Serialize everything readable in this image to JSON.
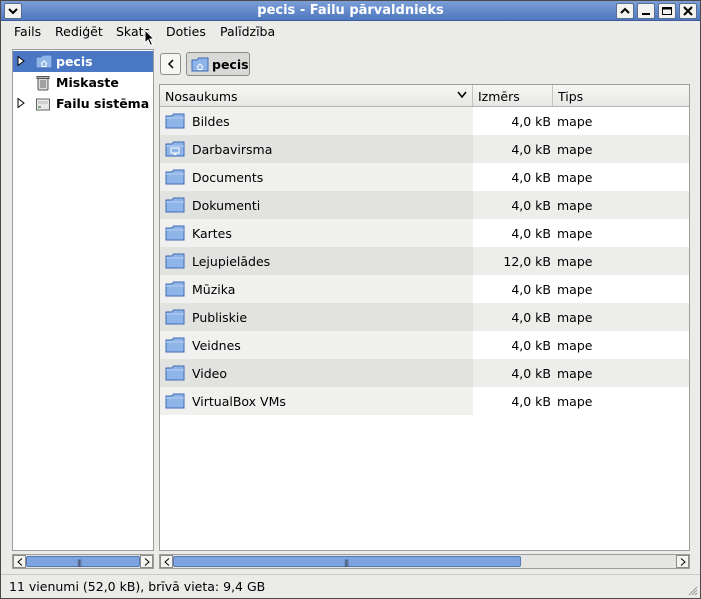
{
  "window": {
    "title": "pecis - Failu pārvaldnieks"
  },
  "titlebar_buttons": [
    {
      "name": "window-menu-button",
      "icon": "chevron-down-icon"
    },
    {
      "name": "shade-button",
      "icon": "chevron-up-icon"
    },
    {
      "name": "minimize-button",
      "icon": "minimize-icon"
    },
    {
      "name": "maximize-button",
      "icon": "maximize-icon"
    },
    {
      "name": "close-button",
      "icon": "close-icon"
    }
  ],
  "menubar": {
    "items": [
      "Fails",
      "Rediģēt",
      "Skats",
      "Doties",
      "Palīdzība"
    ]
  },
  "sidebar": {
    "items": [
      {
        "label": "pecis",
        "icon": "home-folder-icon",
        "expandable": true,
        "selected": true
      },
      {
        "label": "Miskaste",
        "icon": "trash-icon",
        "expandable": false,
        "selected": false
      },
      {
        "label": "Failu sistēma",
        "icon": "drive-icon",
        "expandable": true,
        "selected": false
      }
    ]
  },
  "location": {
    "crumb": "pecis",
    "crumb_icon": "home-folder-icon"
  },
  "filelist": {
    "columns": [
      "Nosaukums",
      "Izmērs",
      "Tips"
    ],
    "rows": [
      {
        "name": "Bildes",
        "size": "4,0 kB",
        "type": "mape",
        "icon": "folder-icon"
      },
      {
        "name": "Darbavirsma",
        "size": "4,0 kB",
        "type": "mape",
        "icon": "desktop-folder-icon"
      },
      {
        "name": "Documents",
        "size": "4,0 kB",
        "type": "mape",
        "icon": "folder-icon"
      },
      {
        "name": "Dokumenti",
        "size": "4,0 kB",
        "type": "mape",
        "icon": "folder-icon"
      },
      {
        "name": "Kartes",
        "size": "4,0 kB",
        "type": "mape",
        "icon": "folder-icon"
      },
      {
        "name": "Lejupielādes",
        "size": "12,0 kB",
        "type": "mape",
        "icon": "folder-icon"
      },
      {
        "name": "Mūzika",
        "size": "4,0 kB",
        "type": "mape",
        "icon": "folder-icon"
      },
      {
        "name": "Publiskie",
        "size": "4,0 kB",
        "type": "mape",
        "icon": "folder-icon"
      },
      {
        "name": "Veidnes",
        "size": "4,0 kB",
        "type": "mape",
        "icon": "folder-icon"
      },
      {
        "name": "Video",
        "size": "4,0 kB",
        "type": "mape",
        "icon": "folder-icon"
      },
      {
        "name": "VirtualBox VMs",
        "size": "4,0 kB",
        "type": "mape",
        "icon": "folder-icon"
      }
    ]
  },
  "statusbar": {
    "text": "11 vienumi (52,0 kB), brīvā vieta: 9,4 GB"
  },
  "colors": {
    "titlebar": "#5c84c9",
    "selection": "#4b78c4",
    "folder": "#6f9ad8",
    "scroll_thumb": "#7da3e0"
  }
}
